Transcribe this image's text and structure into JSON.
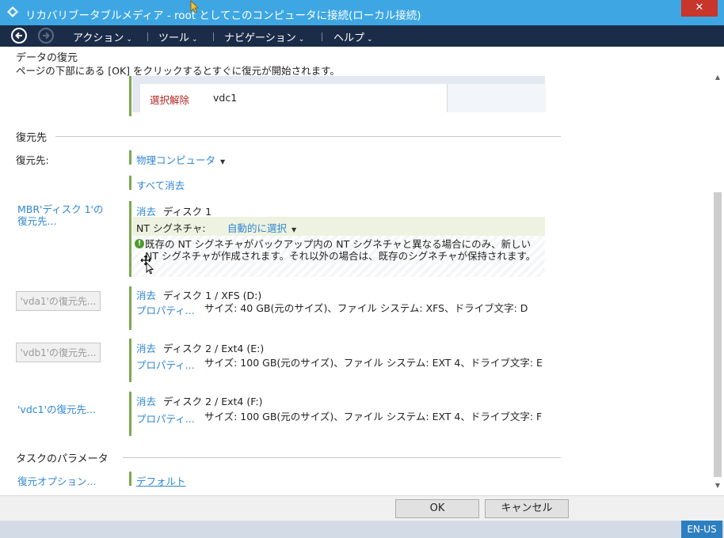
{
  "window": {
    "title": "リカバリブータブルメディア - root としてこのコンピュータに接続(ローカル接続)",
    "close": "✕"
  },
  "menubar": {
    "items": [
      {
        "label": "アクション"
      },
      {
        "label": "ツール"
      },
      {
        "label": "ナビゲーション"
      },
      {
        "label": "ヘルプ"
      }
    ],
    "caret": "⌄"
  },
  "header": {
    "title": "データの復元",
    "subtitle": "ページの下部にある [OK] をクリックするとすぐに復元が開始されます。"
  },
  "selection_table": {
    "deselect": "選択解除",
    "item": "vdc1"
  },
  "restore_to": {
    "section": "復元先",
    "label": "復元先:",
    "target": "物理コンピュータ",
    "clear_all": "すべて消去"
  },
  "mbr": {
    "link": "MBR'ディスク 1'の復元先...",
    "clear": "消去",
    "disk": "ディスク 1",
    "nt_label": "NT シグネチャ:",
    "nt_value": "自動的に選択",
    "info": "既存の NT シグネチャがバックアップ内の NT シグネチャと異なる場合にのみ、新しい NT シグネチャが作成されます。それ以外の場合は、既存のシグネチャが保持されます。"
  },
  "volumes": [
    {
      "button": "'vda1'の復元先...",
      "clear": "消去",
      "disk": "ディスク 1 / XFS (D:)",
      "props": "プロパティ...",
      "desc": "サイズ: 40 GB(元のサイズ)、ファイル システム: XFS、ドライブ文字: D"
    },
    {
      "button": "'vdb1'の復元先...",
      "clear": "消去",
      "disk": "ディスク 2 / Ext4 (E:)",
      "props": "プロパティ...",
      "desc": "サイズ: 100 GB(元のサイズ)、ファイル システム: EXT 4、ドライブ文字: E"
    },
    {
      "button": "'vdc1'の復元先...",
      "clear": "消去",
      "disk": "ディスク 2 / Ext4 (F:)",
      "props": "プロパティ...",
      "desc": "サイズ: 100 GB(元のサイズ)、ファイル システム: EXT 4、ドライブ文字: F"
    }
  ],
  "task_params": {
    "section": "タスクのパラメータ",
    "options_link": "復元オプション...",
    "options_value": "デフォルト"
  },
  "footer": {
    "ok": "OK",
    "cancel": "キャンセル"
  },
  "status": {
    "language": "EN-US"
  },
  "colors": {
    "titlebar": "#3ea7e3",
    "navbar": "#1b2c48",
    "link": "#2f86d4",
    "accent_bar": "#7da84e",
    "close": "#c7352b"
  }
}
